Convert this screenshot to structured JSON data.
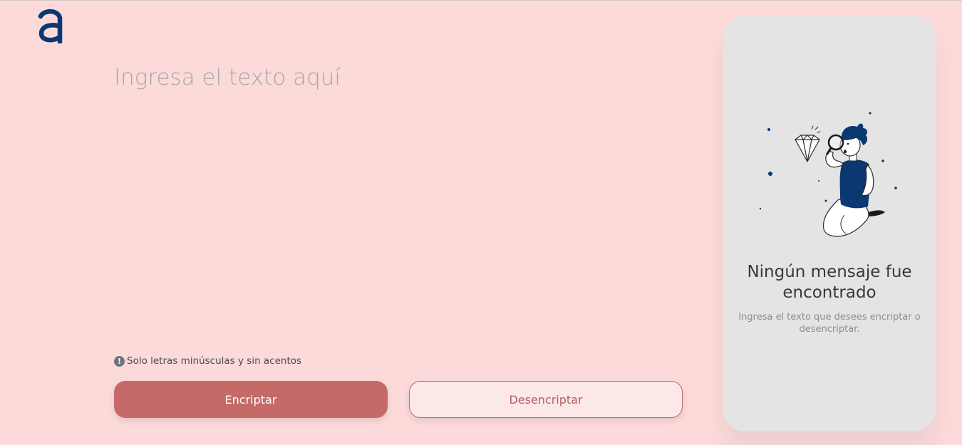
{
  "app": {
    "logo_icon": "alura-a-logo-icon",
    "brand_color": "#0A3871"
  },
  "input": {
    "placeholder": "Ingresa el texto aquí",
    "value": ""
  },
  "hint": {
    "icon": "exclamation-circle-icon",
    "text": "Solo letras minúsculas y sin acentos"
  },
  "actions": {
    "encrypt_label": "Encriptar",
    "decrypt_label": "Desencriptar",
    "encrypt_color": "#C46A68",
    "decrypt_color": "#B65F5F"
  },
  "output_panel": {
    "illustration": "person-with-magnifier-and-diamond-illustration",
    "title": "Ningún mensaje fue encontrado",
    "subtitle": "Ingresa el texto que desees encriptar o desencriptar."
  },
  "colors": {
    "background": "#FCDADA",
    "panel": "#E4E4E4"
  }
}
